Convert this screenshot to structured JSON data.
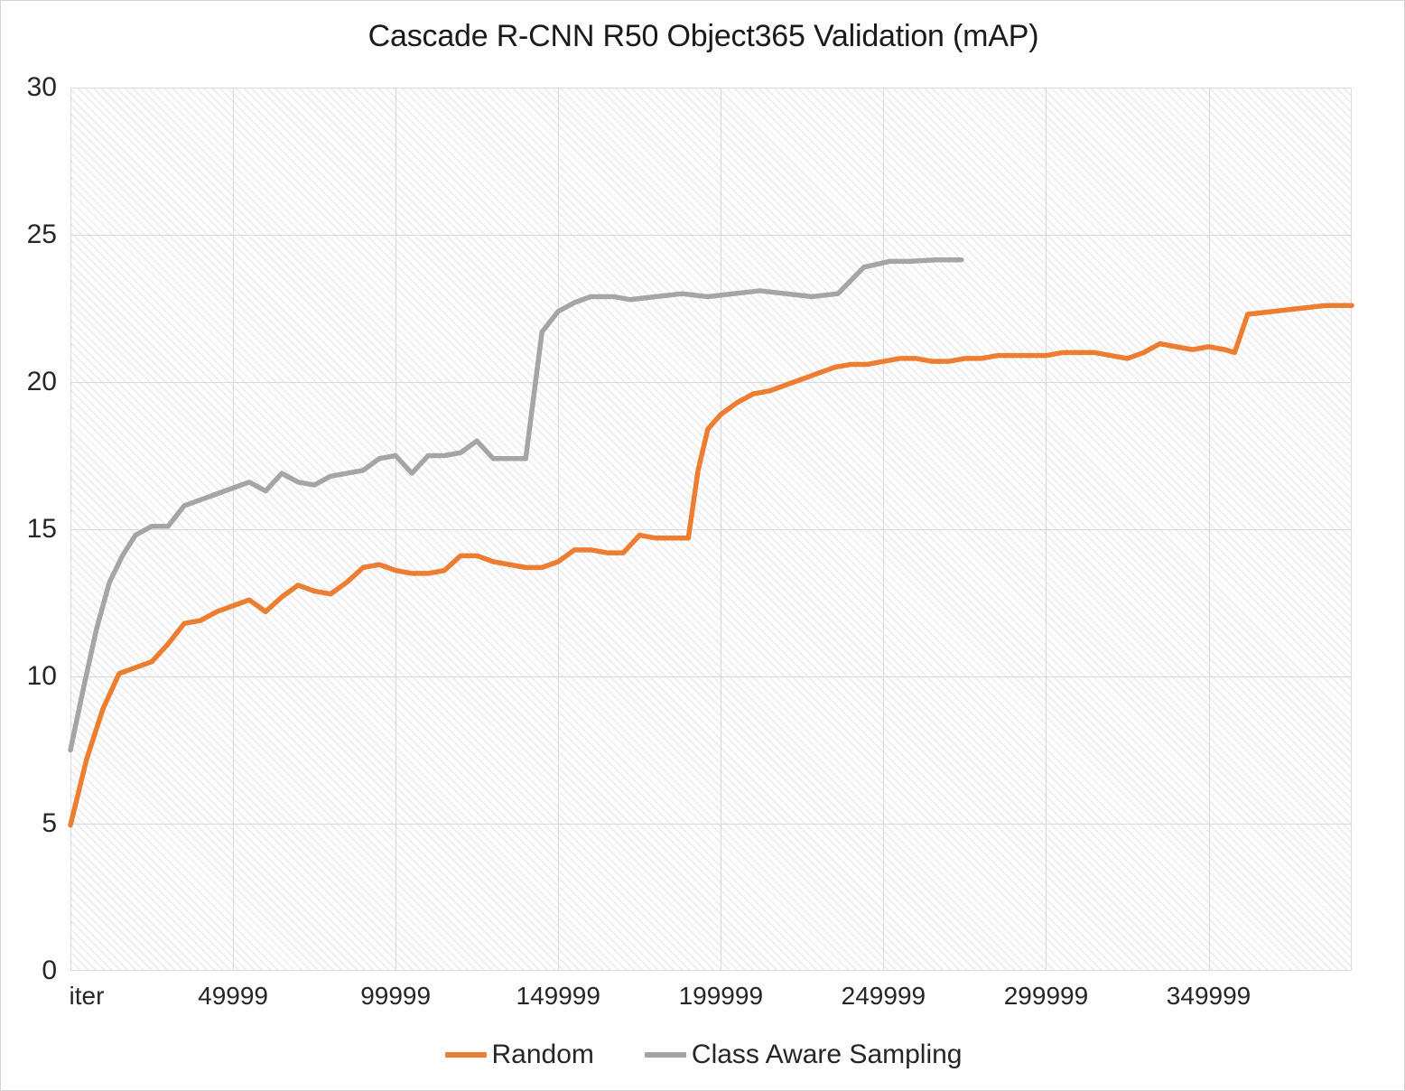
{
  "chart_data": {
    "type": "line",
    "title": "Cascade R-CNN R50 Object365 Validation (mAP)",
    "xlabel": "iter",
    "ylabel": "",
    "ylim": [
      0,
      30
    ],
    "ytick_values": [
      0,
      5,
      10,
      15,
      20,
      25,
      30
    ],
    "ytick_labels": [
      "0",
      "5",
      "10",
      "15",
      "20",
      "25",
      "30"
    ],
    "xtick_labels": [
      "iter",
      "49999",
      "99999",
      "149999",
      "199999",
      "249999",
      "299999",
      "349999"
    ],
    "xtick_values": [
      0,
      49999,
      99999,
      149999,
      199999,
      249999,
      299999,
      349999
    ],
    "xlim": [
      0,
      394000
    ],
    "grid": true,
    "legend_position": "bottom",
    "plot_background": "diagonal-hatch",
    "series": [
      {
        "name": "Random",
        "color": "#ED7D31",
        "x": [
          0,
          5000,
          10000,
          15000,
          20000,
          25000,
          30000,
          35000,
          40000,
          45000,
          50000,
          55000,
          60000,
          65000,
          70000,
          75000,
          80000,
          85000,
          90000,
          95000,
          100000,
          105000,
          110000,
          115000,
          120000,
          125000,
          130000,
          135000,
          140000,
          145000,
          150000,
          155000,
          160000,
          165000,
          170000,
          175000,
          180000,
          185000,
          190000,
          193000,
          196000,
          200000,
          205000,
          210000,
          215000,
          220000,
          225000,
          230000,
          235000,
          240000,
          245000,
          250000,
          255000,
          260000,
          265000,
          270000,
          275000,
          280000,
          285000,
          290000,
          295000,
          300000,
          305000,
          310000,
          315000,
          320000,
          325000,
          330000,
          335000,
          340000,
          345000,
          350000,
          355000,
          358000,
          362000,
          370000,
          378000,
          386000,
          394000
        ],
        "y": [
          4.95,
          7.2,
          8.9,
          10.1,
          10.3,
          10.5,
          11.1,
          11.8,
          11.9,
          12.2,
          12.4,
          12.6,
          12.2,
          12.7,
          13.1,
          12.9,
          12.8,
          13.2,
          13.7,
          13.8,
          13.6,
          13.5,
          13.5,
          13.6,
          14.1,
          14.1,
          13.9,
          13.8,
          13.7,
          13.7,
          13.9,
          14.3,
          14.3,
          14.2,
          14.2,
          14.8,
          14.7,
          14.7,
          14.7,
          17.0,
          18.4,
          18.9,
          19.3,
          19.6,
          19.7,
          19.9,
          20.1,
          20.3,
          20.5,
          20.6,
          20.6,
          20.7,
          20.8,
          20.8,
          20.7,
          20.7,
          20.8,
          20.8,
          20.9,
          20.9,
          20.9,
          20.9,
          21.0,
          21.0,
          21.0,
          20.9,
          20.8,
          21.0,
          21.3,
          21.2,
          21.1,
          21.2,
          21.1,
          21.0,
          22.3,
          22.4,
          22.5,
          22.6,
          22.6
        ]
      },
      {
        "name": "Class Aware Sampling",
        "color": "#A5A5A5",
        "x": [
          0,
          4000,
          8000,
          12000,
          16000,
          20000,
          25000,
          30000,
          35000,
          40000,
          45000,
          50000,
          55000,
          60000,
          65000,
          70000,
          75000,
          80000,
          85000,
          90000,
          95000,
          100000,
          105000,
          110000,
          115000,
          120000,
          125000,
          130000,
          135000,
          140000,
          145000,
          150000,
          155000,
          160000,
          163000,
          167000,
          172000,
          180000,
          188000,
          196000,
          204000,
          212000,
          220000,
          228000,
          236000,
          244000,
          248000,
          252000,
          258000,
          266000,
          274000
        ],
        "y": [
          7.5,
          9.6,
          11.6,
          13.2,
          14.1,
          14.8,
          15.1,
          15.1,
          15.8,
          16.0,
          16.2,
          16.4,
          16.6,
          16.3,
          16.9,
          16.6,
          16.5,
          16.8,
          16.9,
          17.0,
          17.4,
          17.5,
          16.9,
          17.5,
          17.5,
          17.6,
          18.0,
          17.4,
          17.4,
          17.4,
          21.7,
          22.4,
          22.7,
          22.9,
          22.9,
          22.9,
          22.8,
          22.9,
          23.0,
          22.9,
          23.0,
          23.1,
          23.0,
          22.9,
          23.0,
          23.9,
          24.0,
          24.1,
          24.1,
          24.15,
          24.15
        ]
      }
    ]
  }
}
